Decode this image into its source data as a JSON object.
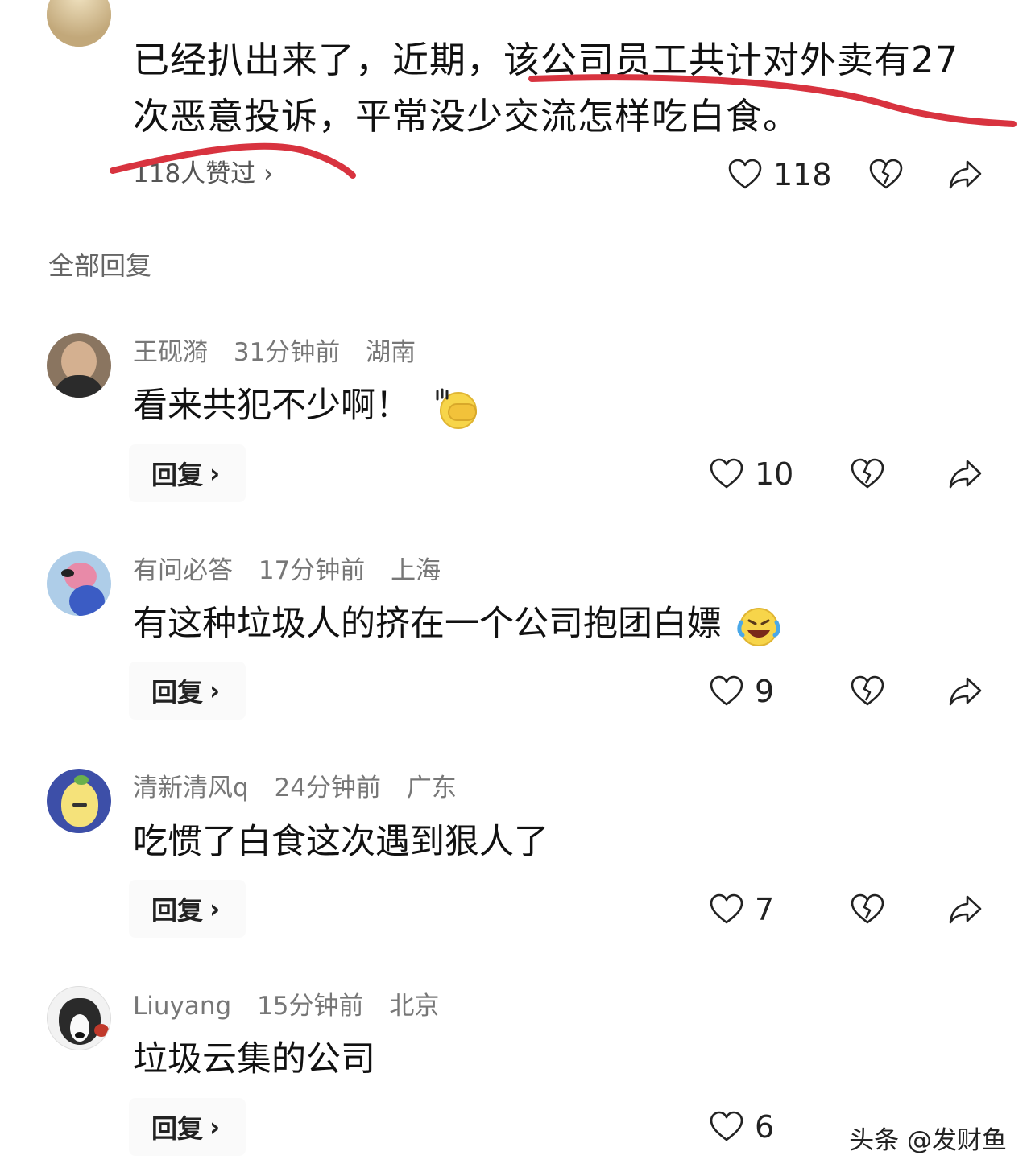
{
  "main_comment": {
    "text": "已经扒出来了，近期，该公司员工共计对外卖有27次恶意投诉，平常没少交流怎样吃白食。",
    "likes_summary": "118人赞过 ›",
    "like_count": "118"
  },
  "section_title": "全部回复",
  "replies": [
    {
      "name": "王砚漪",
      "time": "31分钟前",
      "location": "湖南",
      "text": "看来共犯不少啊！",
      "reply_label": "回复",
      "like_count": "10"
    },
    {
      "name": "有问必答",
      "time": "17分钟前",
      "location": "上海",
      "text": "有这种垃圾人的挤在一个公司抱团白嫖",
      "reply_label": "回复",
      "like_count": "9"
    },
    {
      "name": "清新清风q",
      "time": "24分钟前",
      "location": "广东",
      "text": "吃惯了白食这次遇到狠人了",
      "reply_label": "回复",
      "like_count": "7"
    },
    {
      "name": "Liuyang",
      "time": "15分钟前",
      "location": "北京",
      "text": "垃圾云集的公司",
      "reply_label": "回复",
      "like_count": "6"
    }
  ],
  "watermark": "头条 @发财鱼",
  "colors": {
    "annotation_red": "#d8333f",
    "text_dark": "#111111",
    "text_meta": "#777777"
  },
  "icons": [
    "heart-outline-icon",
    "broken-heart-icon",
    "share-arrow-icon",
    "chevron-right-icon"
  ]
}
